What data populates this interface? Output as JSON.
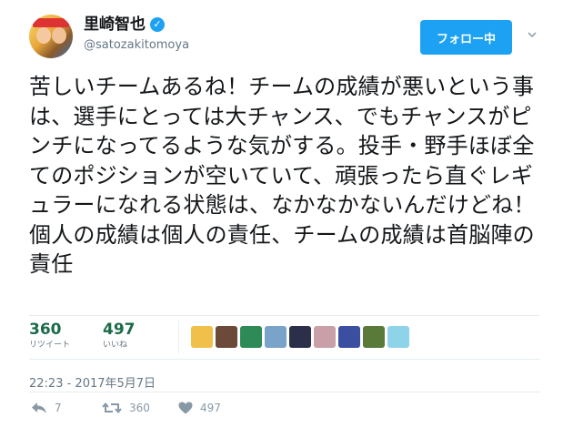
{
  "user": {
    "name": "里崎智也",
    "handle": "@satozakitomoya",
    "verified": true
  },
  "follow_button": {
    "label": "フォロー中"
  },
  "tweet": {
    "text": "苦しいチームあるね！チームの成績が悪いという事は、選手にとっては大チャンス、でもチャンスがピンチになってるような気がする。投手・野手ほぼ全てのポジションが空いていて、頑張ったら直ぐレギュラーになれる状態は、なかなかないんだけどね！個人の成績は個人の責任、チームの成績は首脳陣の責任"
  },
  "stats": {
    "retweets": {
      "value": "360",
      "label": "リツイート"
    },
    "likes": {
      "value": "497",
      "label": "いいね"
    }
  },
  "likers": [
    {
      "name": "liker-avatar-1",
      "color": "#f0c04a"
    },
    {
      "name": "liker-avatar-2",
      "color": "#6b4a3a"
    },
    {
      "name": "liker-avatar-3",
      "color": "#2e8b57"
    },
    {
      "name": "liker-avatar-4",
      "color": "#7aa3c9"
    },
    {
      "name": "liker-avatar-5",
      "color": "#2b2f4a"
    },
    {
      "name": "liker-avatar-6",
      "color": "#c9a0a8"
    },
    {
      "name": "liker-avatar-7",
      "color": "#3b4fa0"
    },
    {
      "name": "liker-avatar-8",
      "color": "#5a7a3a"
    },
    {
      "name": "liker-avatar-9",
      "color": "#8fd3e8"
    }
  ],
  "timestamp": "22:23 - 2017年5月7日",
  "actions": {
    "reply": {
      "icon": "reply-icon",
      "count": "7"
    },
    "retweet": {
      "icon": "retweet-icon",
      "count": "360"
    },
    "like": {
      "icon": "heart-icon",
      "count": "497"
    }
  },
  "colors": {
    "accent": "#1da1f2",
    "stat_number": "#1b6b49",
    "muted": "#657786"
  }
}
